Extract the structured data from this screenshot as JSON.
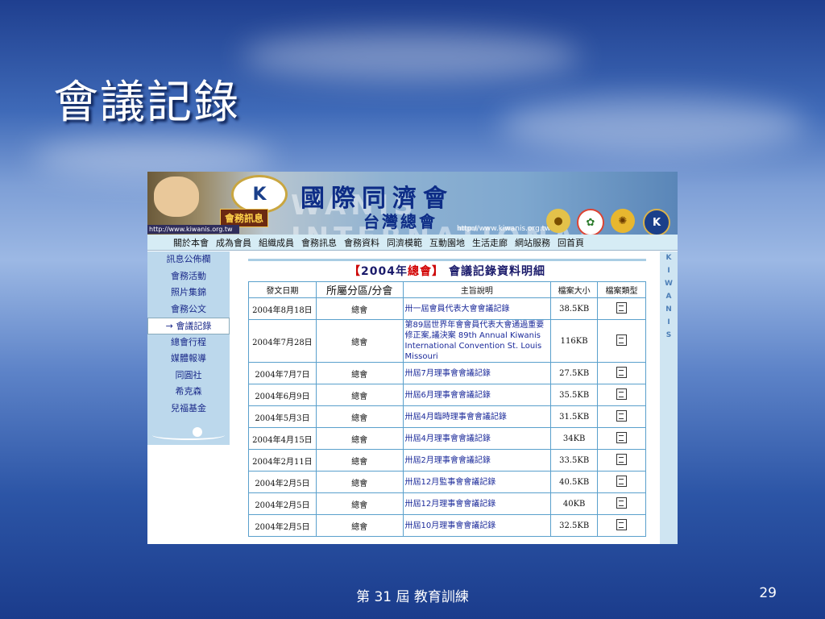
{
  "slide": {
    "title": "會議記錄",
    "footer": "第 31 屆 教育訓練",
    "page_number": "29"
  },
  "banner": {
    "name": "國際同濟會",
    "sub": "台灣總會",
    "news_button": "會務訊息",
    "url_left": "http://www.kiwanis.org.tw",
    "url_right": "http://www.kiwanis.org.tw",
    "logo_letter": "K",
    "watermark": "WANIS INTERNATIONAL"
  },
  "nav": [
    "關於本會",
    "成為會員",
    "組織成員",
    "會務訊息",
    "會務資料",
    "同濟模範",
    "互動園地",
    "生活走廊",
    "網站服務",
    "回首頁"
  ],
  "left_menu": [
    {
      "label": "訊息公佈欄",
      "active": false
    },
    {
      "label": "會務活動",
      "active": false
    },
    {
      "label": "照片集錦",
      "active": false
    },
    {
      "label": "會務公文",
      "active": false
    },
    {
      "label": "→ 會議記錄",
      "active": true
    },
    {
      "label": "總會行程",
      "active": false
    },
    {
      "label": "媒體報導",
      "active": false
    },
    {
      "label": "同圓社",
      "active": false
    },
    {
      "label": "希克森",
      "active": false
    },
    {
      "label": "兒福基金",
      "active": false
    }
  ],
  "right_strip": [
    "K",
    "I",
    "W",
    "A",
    "N",
    "I",
    "S"
  ],
  "caption": {
    "open": "【",
    "year": "2004年",
    "org": "總會",
    "close": "】",
    "text": "會議記錄資料明細"
  },
  "table": {
    "headers": [
      "發文日期",
      "所屬分區/分會",
      "主旨說明",
      "檔案大小",
      "檔案類型"
    ],
    "rows": [
      {
        "date": "2004年8月18日",
        "unit": "總會",
        "desc": "卅一屆會員代表大會會議記錄",
        "size": "38.5KB"
      },
      {
        "date": "2004年7月28日",
        "unit": "總會",
        "desc": "第89屆世界年會會員代表大會通過重要修正案,議決案 89th Annual Kiwanis International Convention St. Louis Missouri",
        "size": "116KB"
      },
      {
        "date": "2004年7月7日",
        "unit": "總會",
        "desc": "卅屆7月理事會會議記錄",
        "size": "27.5KB"
      },
      {
        "date": "2004年6月9日",
        "unit": "總會",
        "desc": "卅屆6月理事會會議記錄",
        "size": "35.5KB"
      },
      {
        "date": "2004年5月3日",
        "unit": "總會",
        "desc": "卅屆4月臨時理事會會議記錄",
        "size": "31.5KB"
      },
      {
        "date": "2004年4月15日",
        "unit": "總會",
        "desc": "卅屆4月理事會會議記錄",
        "size": "34KB"
      },
      {
        "date": "2004年2月11日",
        "unit": "總會",
        "desc": "卅屆2月理事會會議記錄",
        "size": "33.5KB"
      },
      {
        "date": "2004年2月5日",
        "unit": "總會",
        "desc": "卅屆12月監事會會議記錄",
        "size": "40.5KB"
      },
      {
        "date": "2004年2月5日",
        "unit": "總會",
        "desc": "卅屆12月理事會會議記錄",
        "size": "40KB"
      },
      {
        "date": "2004年2月5日",
        "unit": "總會",
        "desc": "卅屆10月理事會會議記錄",
        "size": "32.5KB"
      }
    ]
  }
}
